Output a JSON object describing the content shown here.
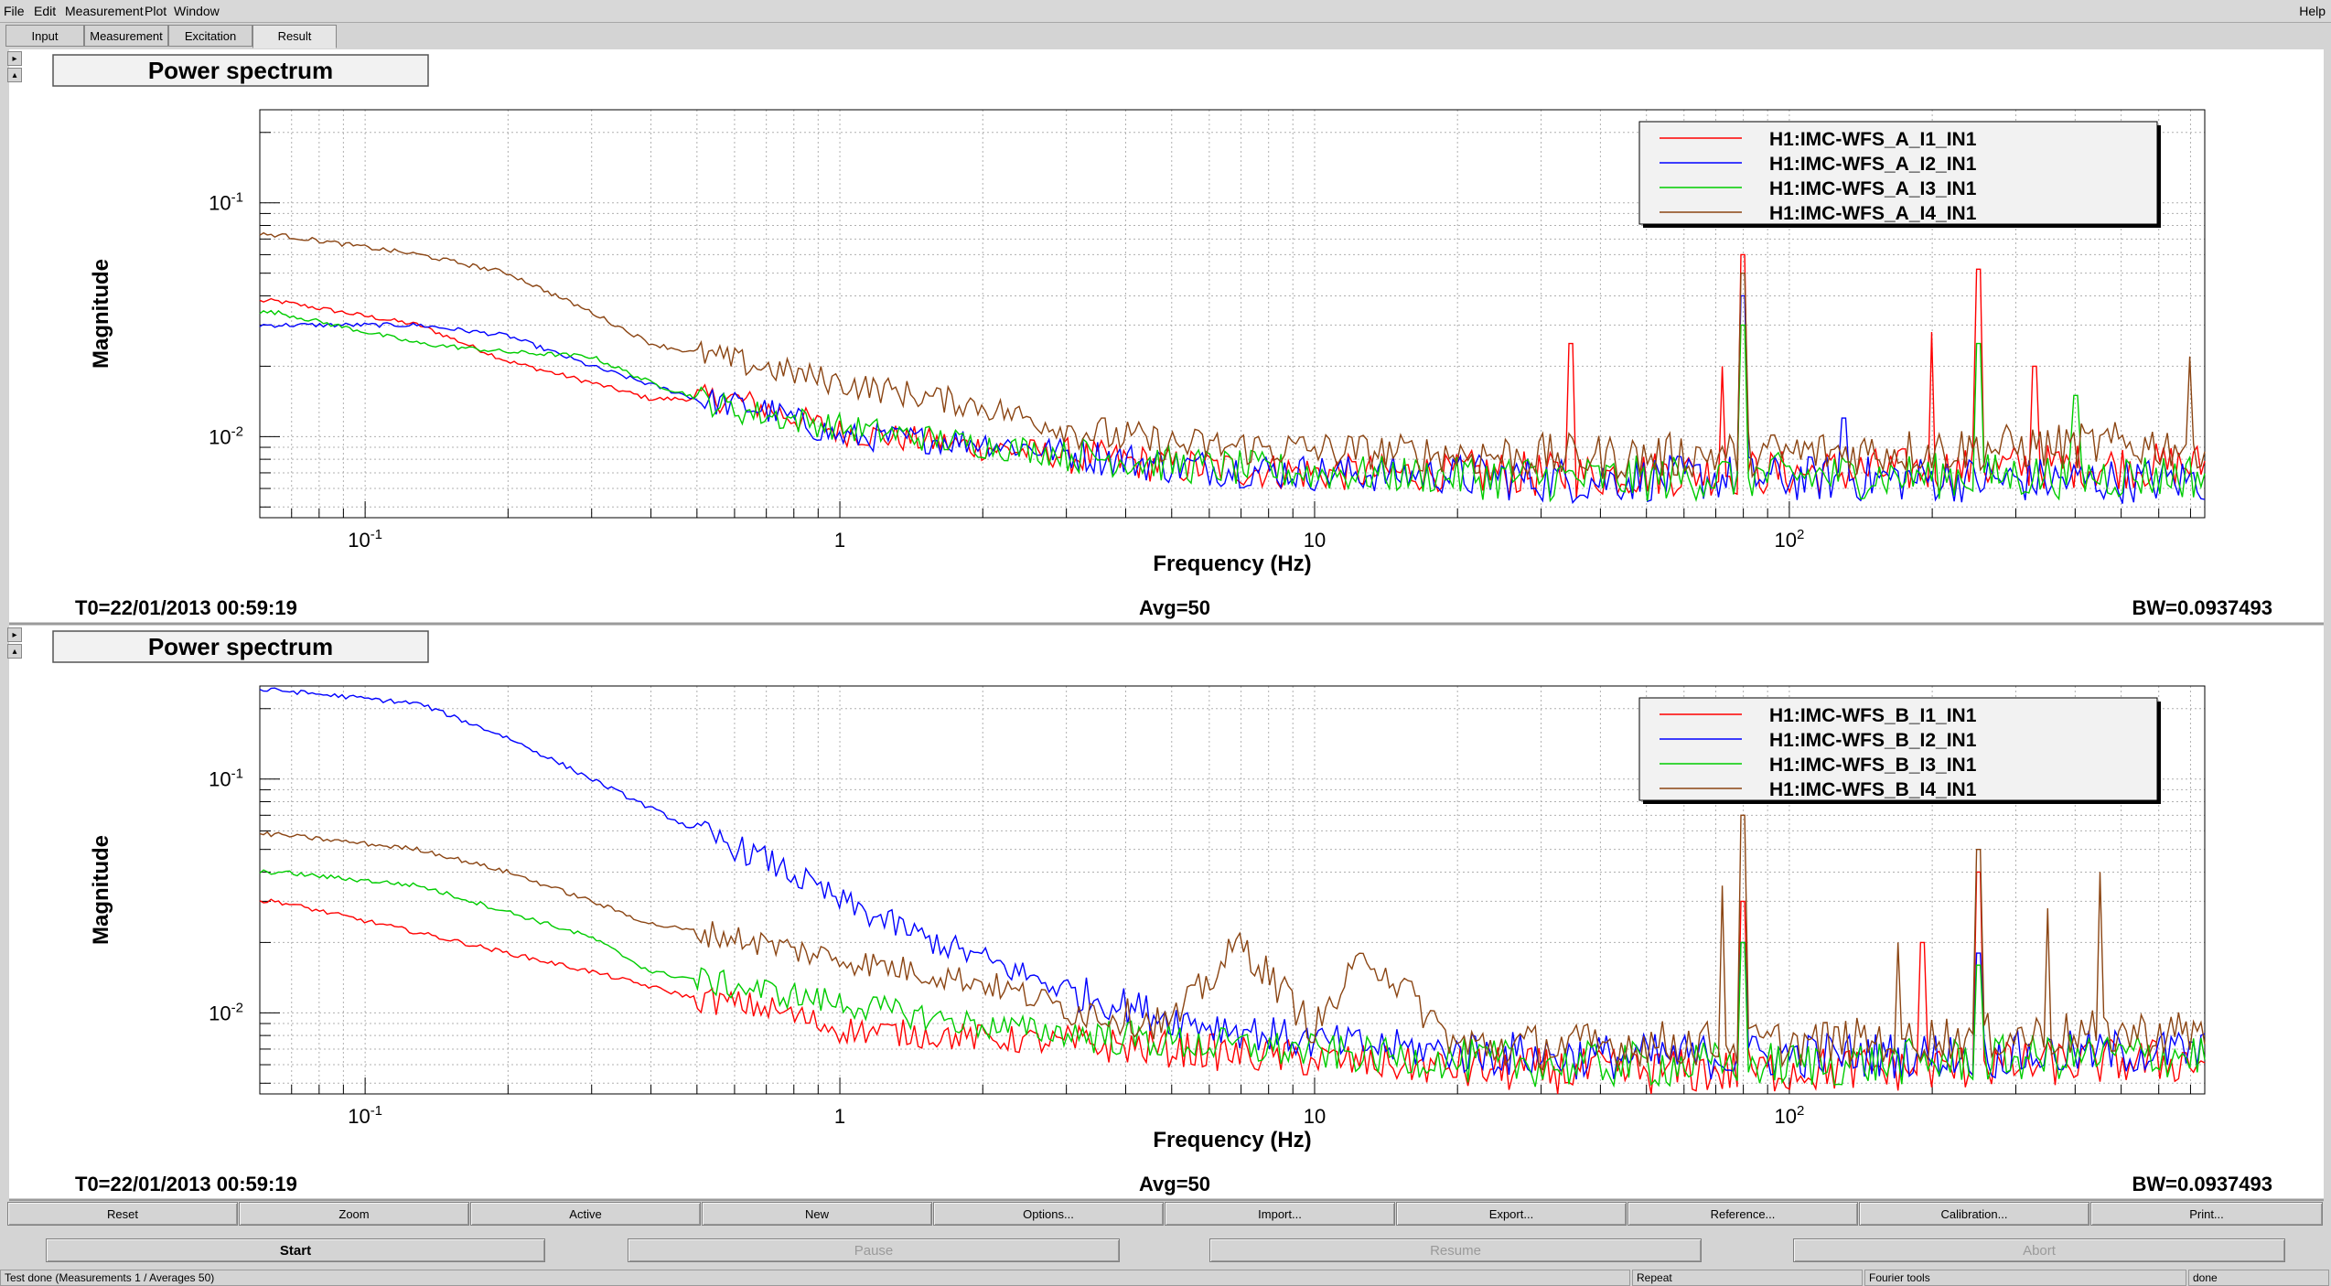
{
  "menu": {
    "items": [
      "File",
      "Edit",
      "Measurement",
      "Plot",
      "Window"
    ],
    "help": "Help"
  },
  "tabs": [
    {
      "label": "Input"
    },
    {
      "label": "Measurement"
    },
    {
      "label": "Excitation"
    },
    {
      "label": "Result",
      "active": true
    }
  ],
  "colors": {
    "series": [
      "#ff0000",
      "#0000ff",
      "#00cc00",
      "#8b4513"
    ]
  },
  "panels": [
    {
      "title": "Power spectrum",
      "xlabel": "Frequency (Hz)",
      "ylabel": "Magnitude",
      "t0": "T0=22/01/2013 00:59:19",
      "avg": "Avg=50",
      "bw": "BW=0.0937493",
      "legend": [
        "H1:IMC-WFS_A_I1_IN1",
        "H1:IMC-WFS_A_I2_IN1",
        "H1:IMC-WFS_A_I3_IN1",
        "H1:IMC-WFS_A_I4_IN1"
      ]
    },
    {
      "title": "Power spectrum",
      "xlabel": "Frequency (Hz)",
      "ylabel": "Magnitude",
      "t0": "T0=22/01/2013 00:59:19",
      "avg": "Avg=50",
      "bw": "BW=0.0937493",
      "legend": [
        "H1:IMC-WFS_B_I1_IN1",
        "H1:IMC-WFS_B_I2_IN1",
        "H1:IMC-WFS_B_I3_IN1",
        "H1:IMC-WFS_B_I4_IN1"
      ]
    }
  ],
  "chart_data": [
    {
      "type": "line",
      "title": "Power spectrum",
      "xlabel": "Frequency (Hz)",
      "ylabel": "Magnitude",
      "xscale": "log",
      "yscale": "log",
      "xlim": [
        0.06,
        750
      ],
      "ylim": [
        0.0045,
        0.25
      ],
      "xticks": [
        {
          "v": 0.1,
          "label": "10^-1"
        },
        {
          "v": 1,
          "label": "1"
        },
        {
          "v": 10,
          "label": "10"
        },
        {
          "v": 100,
          "label": "10^2"
        }
      ],
      "yticks": [
        {
          "v": 0.01,
          "label": "10^-2"
        },
        {
          "v": 0.1,
          "label": "10^-1"
        }
      ],
      "grid": true,
      "legend_position": "top-right",
      "series": [
        {
          "name": "H1:IMC-WFS_A_I1_IN1",
          "x": [
            0.065,
            0.13,
            0.2,
            0.3,
            0.4,
            0.6,
            1,
            2,
            5,
            10,
            20,
            35,
            50,
            80,
            100,
            200,
            300,
            500,
            700
          ],
          "y": [
            0.038,
            0.03,
            0.021,
            0.017,
            0.0145,
            0.0145,
            0.0105,
            0.009,
            0.0075,
            0.007,
            0.007,
            0.0068,
            0.007,
            0.007,
            0.007,
            0.0072,
            0.0074,
            0.0075,
            0.0075
          ],
          "peaks": [
            [
              34.5,
              0.025
            ],
            [
              72,
              0.02
            ],
            [
              80,
              0.06
            ],
            [
              250,
              0.052
            ],
            [
              200,
              0.028
            ],
            [
              330,
              0.02
            ]
          ]
        },
        {
          "name": "H1:IMC-WFS_A_I2_IN1",
          "x": [
            0.065,
            0.13,
            0.2,
            0.3,
            0.5,
            0.7,
            1,
            2,
            5,
            10,
            20,
            35,
            50,
            80,
            100,
            200,
            300,
            500,
            700
          ],
          "y": [
            0.03,
            0.03,
            0.027,
            0.02,
            0.0145,
            0.013,
            0.01,
            0.0095,
            0.0075,
            0.007,
            0.0068,
            0.0065,
            0.0066,
            0.0067,
            0.0066,
            0.0066,
            0.0065,
            0.0065,
            0.0065
          ],
          "peaks": [
            [
              80,
              0.04
            ],
            [
              130,
              0.012
            ]
          ]
        },
        {
          "name": "H1:IMC-WFS_A_I3_IN1",
          "x": [
            0.065,
            0.13,
            0.2,
            0.3,
            0.4,
            0.6,
            1,
            2,
            5,
            10,
            20,
            35,
            50,
            80,
            100,
            200,
            300,
            500,
            700
          ],
          "y": [
            0.034,
            0.025,
            0.023,
            0.022,
            0.017,
            0.013,
            0.011,
            0.0092,
            0.0076,
            0.007,
            0.0068,
            0.0066,
            0.0066,
            0.0068,
            0.0068,
            0.0068,
            0.0068,
            0.0068,
            0.0068
          ],
          "peaks": [
            [
              80,
              0.03
            ],
            [
              250,
              0.025
            ],
            [
              400,
              0.015
            ]
          ]
        },
        {
          "name": "H1:IMC-WFS_A_I4_IN1",
          "x": [
            0.065,
            0.13,
            0.2,
            0.3,
            0.4,
            0.6,
            1,
            2,
            3,
            5,
            10,
            20,
            35,
            50,
            80,
            100,
            200,
            300,
            500,
            700
          ],
          "y": [
            0.073,
            0.06,
            0.05,
            0.034,
            0.025,
            0.021,
            0.017,
            0.0135,
            0.0108,
            0.0092,
            0.0088,
            0.0084,
            0.0082,
            0.0082,
            0.0085,
            0.0085,
            0.0088,
            0.009,
            0.0092,
            0.0092
          ],
          "peaks": [
            [
              80,
              0.05
            ],
            [
              700,
              0.022
            ]
          ]
        }
      ]
    },
    {
      "type": "line",
      "title": "Power spectrum",
      "xlabel": "Frequency (Hz)",
      "ylabel": "Magnitude",
      "xscale": "log",
      "yscale": "log",
      "xlim": [
        0.06,
        750
      ],
      "ylim": [
        0.0045,
        0.25
      ],
      "xticks": [
        {
          "v": 0.1,
          "label": "10^-1"
        },
        {
          "v": 1,
          "label": "1"
        },
        {
          "v": 10,
          "label": "10"
        },
        {
          "v": 100,
          "label": "10^2"
        }
      ],
      "yticks": [
        {
          "v": 0.01,
          "label": "10^-2"
        },
        {
          "v": 0.1,
          "label": "10^-1"
        }
      ],
      "grid": true,
      "legend_position": "top-right",
      "series": [
        {
          "name": "H1:IMC-WFS_B_I1_IN1",
          "x": [
            0.065,
            0.13,
            0.2,
            0.3,
            0.5,
            0.7,
            1,
            2,
            5,
            10,
            20,
            35,
            50,
            80,
            100,
            200,
            300,
            500,
            700
          ],
          "y": [
            0.03,
            0.022,
            0.018,
            0.015,
            0.0115,
            0.0105,
            0.0085,
            0.0078,
            0.007,
            0.0063,
            0.0058,
            0.0056,
            0.0056,
            0.0056,
            0.0057,
            0.0058,
            0.006,
            0.0062,
            0.0062
          ],
          "peaks": [
            [
              80,
              0.03
            ],
            [
              190,
              0.02
            ],
            [
              250,
              0.04
            ]
          ]
        },
        {
          "name": "H1:IMC-WFS_B_I2_IN1",
          "x": [
            0.065,
            0.13,
            0.2,
            0.3,
            0.5,
            0.7,
            1,
            1.5,
            2,
            3,
            5,
            10,
            20,
            35,
            50,
            80,
            100,
            200,
            300,
            500,
            700
          ],
          "y": [
            0.24,
            0.21,
            0.15,
            0.1,
            0.06,
            0.045,
            0.03,
            0.021,
            0.017,
            0.0125,
            0.0095,
            0.0075,
            0.0068,
            0.0065,
            0.0065,
            0.0065,
            0.0066,
            0.0066,
            0.0066,
            0.0068,
            0.0068
          ],
          "peaks": [
            [
              80,
              0.02
            ],
            [
              250,
              0.018
            ]
          ]
        },
        {
          "name": "H1:IMC-WFS_B_I3_IN1",
          "x": [
            0.065,
            0.13,
            0.2,
            0.3,
            0.4,
            0.6,
            1,
            2,
            5,
            10,
            20,
            35,
            50,
            80,
            100,
            200,
            300,
            500,
            700
          ],
          "y": [
            0.04,
            0.035,
            0.027,
            0.021,
            0.015,
            0.013,
            0.011,
            0.0088,
            0.0075,
            0.0068,
            0.0062,
            0.006,
            0.006,
            0.006,
            0.006,
            0.0062,
            0.0064,
            0.0066,
            0.0066
          ],
          "peaks": [
            [
              80,
              0.02
            ],
            [
              250,
              0.016
            ]
          ]
        },
        {
          "name": "H1:IMC-WFS_B_I4_IN1",
          "x": [
            0.065,
            0.13,
            0.2,
            0.3,
            0.4,
            0.6,
            1,
            2,
            3,
            5,
            7,
            10,
            13,
            20,
            35,
            50,
            80,
            100,
            200,
            300,
            500,
            700
          ],
          "y": [
            0.058,
            0.05,
            0.04,
            0.03,
            0.024,
            0.021,
            0.017,
            0.0135,
            0.0105,
            0.009,
            0.02,
            0.0085,
            0.018,
            0.0072,
            0.0072,
            0.0074,
            0.0074,
            0.0074,
            0.0078,
            0.008,
            0.0082,
            0.0082
          ],
          "peaks": [
            [
              72,
              0.035
            ],
            [
              80,
              0.07
            ],
            [
              170,
              0.02
            ],
            [
              250,
              0.05
            ],
            [
              350,
              0.028
            ],
            [
              450,
              0.04
            ]
          ]
        }
      ]
    }
  ],
  "buttons": [
    "Reset",
    "Zoom",
    "Active",
    "New",
    "Options...",
    "Import...",
    "Export...",
    "Reference...",
    "Calibration...",
    "Print..."
  ],
  "controls": [
    {
      "label": "Start",
      "enabled": true
    },
    {
      "label": "Pause",
      "enabled": false
    },
    {
      "label": "Resume",
      "enabled": false
    },
    {
      "label": "Abort",
      "enabled": false
    }
  ],
  "status": {
    "message": "Test done (Measurements 1 / Averages 50)",
    "mode": "Repeat",
    "tools": "Fourier tools",
    "state": "done"
  }
}
